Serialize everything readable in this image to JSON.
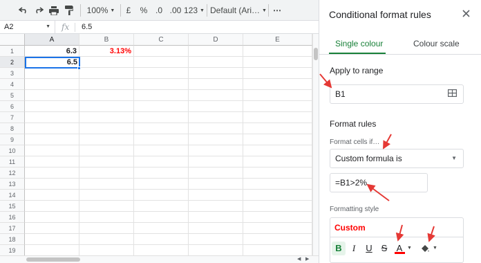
{
  "toolbar": {
    "zoom": "100%",
    "currency": "£",
    "percent": "%",
    "decrease_decimals": ".0",
    "increase_decimals": ".00",
    "more_formats": "123",
    "font": "Default (Ari…",
    "more": "⋯"
  },
  "formula_bar": {
    "cell_ref": "A2",
    "fx": "fx",
    "value": "6.5"
  },
  "grid": {
    "columns": [
      "A",
      "B",
      "C",
      "D",
      "E"
    ],
    "rows": [
      "1",
      "2",
      "3",
      "4",
      "5",
      "6",
      "7",
      "8",
      "9",
      "10",
      "11",
      "12",
      "13",
      "14",
      "15",
      "16",
      "17",
      "18",
      "19"
    ],
    "cells": {
      "A1": "6.3",
      "B1": "3.13%",
      "A2": "6.5"
    }
  },
  "panel": {
    "title": "Conditional format rules",
    "tabs": [
      {
        "label": "Single colour",
        "active": true
      },
      {
        "label": "Colour scale",
        "active": false
      }
    ],
    "apply_label": "Apply to range",
    "range_value": "B1",
    "format_rules_label": "Format rules",
    "format_cells_if": "Format cells if…",
    "condition": "Custom formula is",
    "formula": "=B1>2%",
    "formatting_style_label": "Formatting style",
    "style_preview": "Custom",
    "format_buttons": {
      "bold": "B",
      "italic": "I",
      "underline": "U",
      "strikethrough": "S",
      "text_color": "A"
    }
  },
  "colors": {
    "accent_green": "#188038",
    "selection_blue": "#1a73e8",
    "highlight_red": "#ff0000",
    "annotation_arrow": "#e53935"
  }
}
